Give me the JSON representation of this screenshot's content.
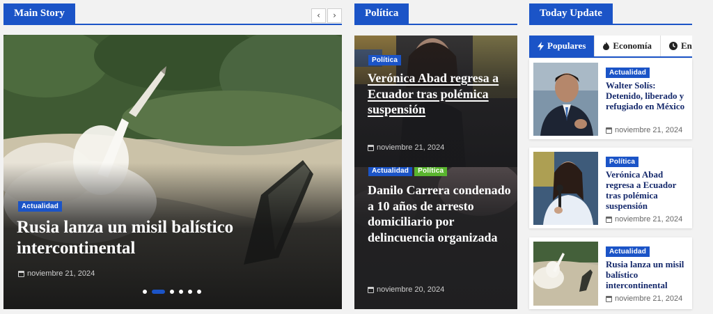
{
  "main_story": {
    "section_title": "Main Story",
    "prev_icon": "‹",
    "next_icon": "›",
    "category": "Actualidad",
    "title": "Rusia lanza un misil balístico intercontinental",
    "date": "noviembre 21, 2024",
    "slides": [
      0,
      1,
      2,
      3,
      4,
      5
    ],
    "active_slide": 1
  },
  "politica": {
    "section_title": "Política",
    "cards": [
      {
        "categories": [
          "Política"
        ],
        "title": "Verónica Abad regresa a Ecuador tras polémica suspensión",
        "date": "noviembre 21, 2024"
      },
      {
        "categories": [
          "Actualidad",
          "Política"
        ],
        "title": "Danilo Carrera condenado a 10 años de arresto domiciliario por delincuencia organizada",
        "date": "noviembre 20, 2024"
      }
    ]
  },
  "today_update": {
    "section_title": "Today Update",
    "tabs": [
      {
        "label": "Populares",
        "icon": "bolt-icon"
      },
      {
        "label": "Economía",
        "icon": "flame-icon"
      },
      {
        "label": "Entretenimiento",
        "icon": "clock-icon"
      }
    ],
    "items": [
      {
        "category": "Actualidad",
        "title": "Walter Solís: Detenido, liberado y refugiado en México",
        "date": "noviembre 21, 2024"
      },
      {
        "category": "Política",
        "title": "Verónica Abad regresa a Ecuador tras polémica suspensión",
        "date": "noviembre 21, 2024"
      },
      {
        "category": "Actualidad",
        "title": "Rusia lanza un misil balístico intercontinental",
        "date": "noviembre 21, 2024"
      }
    ]
  },
  "colors": {
    "accent": "#1b54c7",
    "green": "#5ab52f",
    "dark": "#1e1e1e"
  }
}
